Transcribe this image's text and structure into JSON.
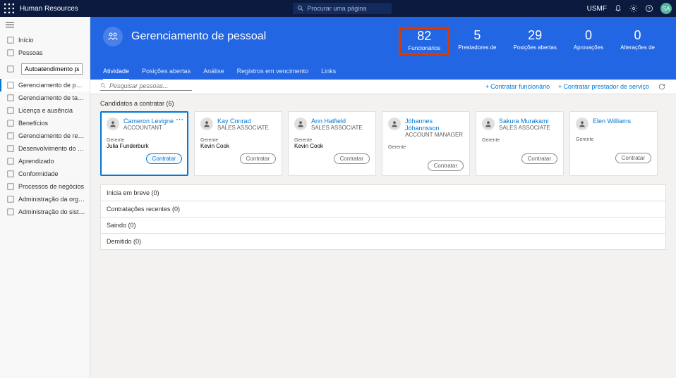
{
  "topbar": {
    "brand": "Human Resources",
    "search_placeholder": "Procurar uma página",
    "company": "USMF",
    "avatar_initials": "SA"
  },
  "sidebar": {
    "self_service_value": "Autoatendimento para funcio...",
    "items": [
      {
        "id": "inicio",
        "label": "Início",
        "icon": "home"
      },
      {
        "id": "pessoas",
        "label": "Pessoas",
        "icon": "people"
      },
      {
        "id": "autoatendimento",
        "label": "",
        "icon": "selfservice",
        "is_input": true
      },
      {
        "id": "gerenciamento-pessoal",
        "label": "Gerenciamento de pessoal",
        "icon": "people",
        "active": true
      },
      {
        "id": "gerenciamento-tarefas",
        "label": "Gerenciamento de tarefas",
        "icon": "tasks"
      },
      {
        "id": "licenca",
        "label": "Licença e ausência",
        "icon": "leave"
      },
      {
        "id": "beneficios",
        "label": "Benefícios",
        "icon": "benefits"
      },
      {
        "id": "remuneracao",
        "label": "Gerenciamento de remuneraç...",
        "icon": "comp"
      },
      {
        "id": "desenvolvimento",
        "label": "Desenvolvimento do funcioná...",
        "icon": "dev"
      },
      {
        "id": "aprendizado",
        "label": "Aprendizado",
        "icon": "learn"
      },
      {
        "id": "conformidade",
        "label": "Conformidade",
        "icon": "compliance"
      },
      {
        "id": "processos",
        "label": "Processos de negócios",
        "icon": "process"
      },
      {
        "id": "admin-org",
        "label": "Administração da organização",
        "icon": "admin"
      },
      {
        "id": "admin-sistema",
        "label": "Administração do sistema",
        "icon": "admin"
      }
    ]
  },
  "hero": {
    "title": "Gerenciamento de pessoal",
    "metrics": [
      {
        "value": "82",
        "label": "Funcionários",
        "highlight": true
      },
      {
        "value": "5",
        "label": "Prestadores de"
      },
      {
        "value": "29",
        "label": "Posições abertas"
      },
      {
        "value": "0",
        "label": "Aprovações"
      },
      {
        "value": "0",
        "label": "Alterações de"
      }
    ],
    "tabs": [
      {
        "label": "Atividade",
        "active": true
      },
      {
        "label": "Posições abertas"
      },
      {
        "label": "Análise"
      },
      {
        "label": "Registros em vencimento"
      },
      {
        "label": "Links"
      }
    ]
  },
  "actionbar": {
    "search_placeholder": "Pesquisar pessoas...",
    "hire_employee": "Contratar funcionário",
    "hire_contractor": "Contratar prestador de serviço"
  },
  "candidates": {
    "title": "Candidatos a contratar (6)",
    "manager_label": "Gerente",
    "hire_btn": "Contratar",
    "items": [
      {
        "name": "Cameron Levigne",
        "role": "ACCOUNTANT",
        "manager": "Julia Funderburk",
        "selected": true,
        "dots": true
      },
      {
        "name": "Kay Conrad",
        "role": "SALES ASSOCIATE",
        "manager": "Kevin Cook"
      },
      {
        "name": "Ann Hatfield",
        "role": "SALES ASSOCIATE",
        "manager": "Kevin Cook"
      },
      {
        "name": "Jóhannes Jóhannsson",
        "role": "ACCOUNT MANAGER",
        "manager": ""
      },
      {
        "name": "Sakura Murakami",
        "role": "SALES ASSOCIATE",
        "manager": ""
      },
      {
        "name": "Elen Williams",
        "role": "",
        "manager": ""
      }
    ]
  },
  "sections": [
    {
      "label": "Inicia em breve (0)"
    },
    {
      "label": "Contratações recentes (0)"
    },
    {
      "label": "Saindo (0)"
    },
    {
      "label": "Demitido (0)"
    }
  ]
}
